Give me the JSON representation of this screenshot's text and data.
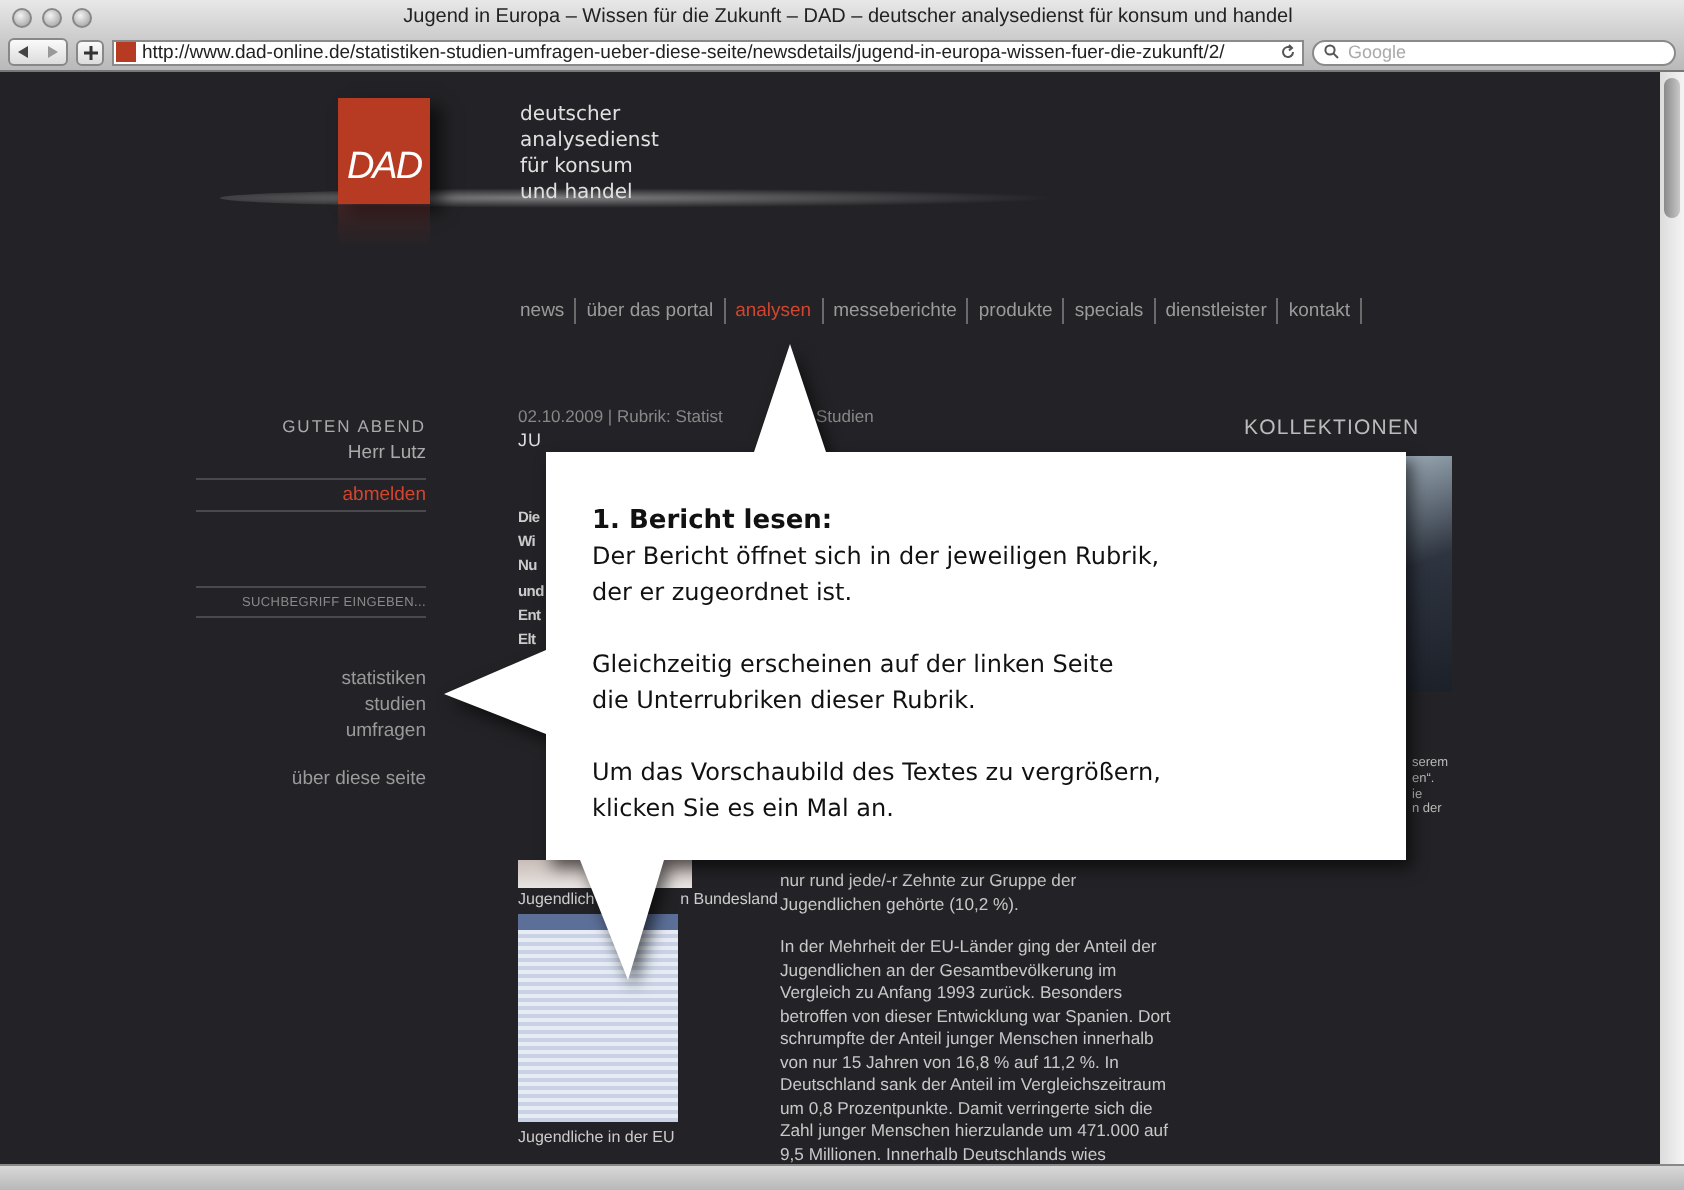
{
  "window": {
    "title": "Jugend in Europa – Wissen für die Zukunft – DAD – deutscher analysedienst für konsum und handel",
    "url": "http://www.dad-online.de/statistiken-studien-umfragen-ueber-diese-seite/newsdetails/jugend-in-europa-wissen-fuer-die-zukunft/2/",
    "search": {
      "placeholder": "Google"
    }
  },
  "header": {
    "logo": "DAD",
    "tagline": [
      "deutscher",
      "analysedienst",
      "für konsum",
      "und handel"
    ]
  },
  "nav": [
    {
      "label": "news",
      "selected": false
    },
    {
      "label": "über das portal",
      "selected": false
    },
    {
      "label": "analysen",
      "selected": true
    },
    {
      "label": "messeberichte",
      "selected": false
    },
    {
      "label": "produkte",
      "selected": false
    },
    {
      "label": "specials",
      "selected": false
    },
    {
      "label": "dienstleister",
      "selected": false
    },
    {
      "label": "kontakt",
      "selected": false
    }
  ],
  "sidebar": {
    "greeting": "GUTEN ABEND",
    "user": "Herr Lutz",
    "logout": "abmelden",
    "search": {
      "placeholder": "SUCHBEGRIFF EINGEBEN..."
    },
    "subnav": [
      {
        "label": "statistiken"
      },
      {
        "label": "studien"
      },
      {
        "label": "umfragen"
      }
    ],
    "about": "über diese seite"
  },
  "article": {
    "meta": [
      "02.10.2009 | Rubrik: Statist",
      "Studien"
    ],
    "headline_fragment": "JU",
    "intro_fragments": [
      "Die",
      "Wi",
      "Nu",
      "und",
      "Ent",
      "Elt"
    ],
    "thumbnails": [
      {
        "caption": [
          "Jugendlich",
          "n Bundesland"
        ]
      },
      {
        "caption": [
          "Jugendliche in der EU"
        ]
      }
    ],
    "paragraphs": [
      [
        "nur rund jede/-r Zehnte zur Gruppe der",
        "Jugendlichen gehörte (10,2 %)."
      ],
      [
        "In der Mehrheit der EU-Länder ging der Anteil der",
        "Jugendlichen an der Gesamtbevölkerung im",
        "Vergleich zu Anfang 1993 zurück. Besonders",
        "betroffen von dieser Entwicklung war Spanien. Dort",
        "schrumpfte der Anteil junger Menschen innerhalb",
        "von nur 15 Jahren von 16,8 % auf 11,2 %. In",
        "Deutschland sank der Anteil im Vergleichszeitraum",
        "um 0,8 Prozentpunkte. Damit verringerte sich die",
        "Zahl junger Menschen hierzulande um 471.000 auf",
        "9,5 Millionen. Innerhalb Deutschlands wies"
      ]
    ]
  },
  "collections": {
    "title": "KOLLEKTIONEN",
    "fragments": [
      "serem",
      "en“.",
      "ie",
      "n der"
    ]
  },
  "callout": {
    "title": "1. Bericht lesen:",
    "paragraphs": [
      [
        "Der Bericht öffnet sich in der jeweiligen Rubrik,",
        "der er zugeordnet ist."
      ],
      [
        "Gleichzeitig erscheinen auf der linken Seite",
        "die Unterrubriken dieser Rubrik."
      ],
      [
        "Um das Vorschaubild des Textes zu vergrößern,",
        "klicken Sie es ein Mal an."
      ]
    ]
  }
}
